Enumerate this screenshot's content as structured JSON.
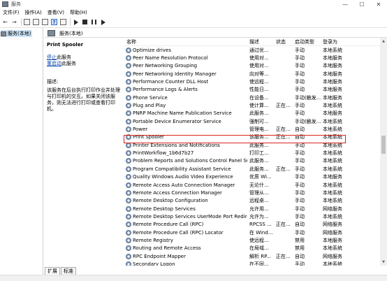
{
  "window": {
    "title": "服务"
  },
  "menu": [
    "文件(F)",
    "操作(A)",
    "查看(V)",
    "帮助(H)"
  ],
  "tree": {
    "root_label": "服务(本地)"
  },
  "header": {
    "label": "服务(本地)"
  },
  "description": {
    "service_name": "Print Spooler",
    "stop_link": "停止",
    "stop_suffix": "此服务",
    "restart_link": "重启动",
    "restart_suffix": "此服务",
    "desc_label": "描述:",
    "desc_text": "该服务在后台执行打印作业并处理与打印机的交互。如果关闭该服务，则无法进行打印或查看打印机。"
  },
  "columns": {
    "name": "名称",
    "desc": "描述",
    "status": "状态",
    "startup": "启动类型",
    "logon": "登录为"
  },
  "rows": [
    {
      "name": "Optimize drives",
      "desc": "通过优...",
      "status": "",
      "startup": "手动",
      "logon": "本地系统"
    },
    {
      "name": "Peer Name Resolution Protocol",
      "desc": "使用对...",
      "status": "",
      "startup": "手动",
      "logon": "本地服务"
    },
    {
      "name": "Peer Networking Grouping",
      "desc": "使用对...",
      "status": "",
      "startup": "手动",
      "logon": "本地服务"
    },
    {
      "name": "Peer Networking Identity Manager",
      "desc": "向对等...",
      "status": "",
      "startup": "手动",
      "logon": "本地服务"
    },
    {
      "name": "Performance Counter DLL Host",
      "desc": "使远程...",
      "status": "",
      "startup": "手动",
      "logon": "本地服务"
    },
    {
      "name": "Performance Logs & Alerts",
      "desc": "性能日...",
      "status": "",
      "startup": "手动",
      "logon": "本地服务"
    },
    {
      "name": "Phone Service",
      "desc": "在设备...",
      "status": "",
      "startup": "手动(触发...",
      "logon": "本地服务"
    },
    {
      "name": "Plug and Play",
      "desc": "使计算...",
      "status": "正在...",
      "startup": "手动",
      "logon": "本地系统"
    },
    {
      "name": "PNRP Machine Name Publication Service",
      "desc": "此服务...",
      "status": "",
      "startup": "手动",
      "logon": "本地服务"
    },
    {
      "name": "Portable Device Enumerator Service",
      "desc": "强制可...",
      "status": "",
      "startup": "手动(触发...",
      "logon": "本地系统"
    },
    {
      "name": "Power",
      "desc": "管理电...",
      "status": "正在...",
      "startup": "自动",
      "logon": "本地系统"
    },
    {
      "name": "Print Spooler",
      "desc": "该服务...",
      "status": "正在...",
      "startup": "自动",
      "logon": "本地系统"
    },
    {
      "name": "Printer Extensions and Notifications",
      "desc": "此服务...",
      "status": "",
      "startup": "手动",
      "logon": "本地系统"
    },
    {
      "name": "PrintWorkflow_1b6d7b27",
      "desc": "打印工...",
      "status": "",
      "startup": "手动",
      "logon": "本地系统"
    },
    {
      "name": "Problem Reports and Solutions Control Panel Supp...",
      "desc": "此服务...",
      "status": "",
      "startup": "手动",
      "logon": "本地系统"
    },
    {
      "name": "Program Compatibility Assistant Service",
      "desc": "此服务...",
      "status": "正在...",
      "startup": "手动",
      "logon": "本地系统"
    },
    {
      "name": "Quality Windows Audio Video Experience",
      "desc": "优质 Wi...",
      "status": "",
      "startup": "手动",
      "logon": "本地服务"
    },
    {
      "name": "Remote Access Auto Connection Manager",
      "desc": "无论什...",
      "status": "",
      "startup": "手动",
      "logon": "本地系统"
    },
    {
      "name": "Remote Access Connection Manager",
      "desc": "管理从...",
      "status": "",
      "startup": "手动",
      "logon": "本地系统"
    },
    {
      "name": "Remote Desktop Configuration",
      "desc": "远程桌...",
      "status": "",
      "startup": "手动",
      "logon": "本地系统"
    },
    {
      "name": "Remote Desktop Services",
      "desc": "允许用...",
      "status": "",
      "startup": "手动",
      "logon": "网络服务"
    },
    {
      "name": "Remote Desktop Services UserMode Port Redirector",
      "desc": "允许为...",
      "status": "",
      "startup": "手动",
      "logon": "本地系统"
    },
    {
      "name": "Remote Procedure Call (RPC)",
      "desc": "RPCSS ...",
      "status": "正在...",
      "startup": "自动",
      "logon": "网络服务"
    },
    {
      "name": "Remote Procedure Call (RPC) Locator",
      "desc": "在 Wind...",
      "status": "",
      "startup": "手动",
      "logon": "网络服务"
    },
    {
      "name": "Remote Registry",
      "desc": "使远程...",
      "status": "",
      "startup": "禁用",
      "logon": "本地服务"
    },
    {
      "name": "Routing and Remote Access",
      "desc": "在局域...",
      "status": "",
      "startup": "禁用",
      "logon": "本地系统"
    },
    {
      "name": "RPC Endpoint Mapper",
      "desc": "解析 RP...",
      "status": "正在...",
      "startup": "自动",
      "logon": "网络服务"
    },
    {
      "name": "Secondary Logon",
      "desc": "在不同...",
      "status": "",
      "startup": "手动",
      "logon": "本地系统"
    }
  ],
  "tabs": [
    "扩展",
    "标准"
  ]
}
